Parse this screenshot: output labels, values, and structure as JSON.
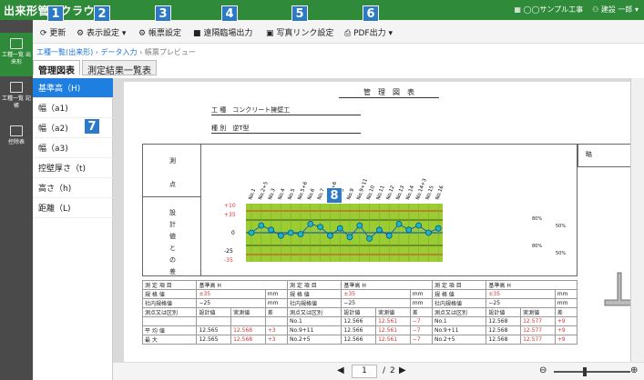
{
  "app": {
    "title": "出来形管理クラウド",
    "org": "◯◯サンプル工事",
    "user": "建設 一郎"
  },
  "toolbar": {
    "refresh": "更新",
    "display": "表示設定",
    "form": "帳票設定",
    "remote": "遠隔臨場出力",
    "photo": "写真リンク設定",
    "pdf": "PDF出力"
  },
  "sidebar": [
    {
      "label": "工種一覧 出来形"
    },
    {
      "label": "工種一覧 記帳"
    },
    {
      "label": "控除表"
    }
  ],
  "breadcrumb": {
    "a": "工種一覧(出来形)",
    "b": "データ入力",
    "c": "帳票プレビュー",
    "sep": "›"
  },
  "tabs": [
    "管理図表",
    "測定結果一覧表"
  ],
  "left_items": [
    "基準高（H)",
    "幅（a1)",
    "幅（a2)",
    "幅（a3)",
    "控壁厚さ（t)",
    "高さ（h)",
    "距離（L)"
  ],
  "badges": [
    "1",
    "2",
    "3",
    "4",
    "5",
    "6",
    "7",
    "8"
  ],
  "sheet": {
    "title": "管　理　図　表",
    "koushu_label": "工 種",
    "koushu": "コンクリート擁壁工",
    "shubetsu_label": "種 別",
    "shubetsu": "逆T型",
    "sokuten_label1": "測",
    "sokuten_label2": "点",
    "vertical_label": "設計値との差",
    "right_label": "略",
    "pct1": "80%",
    "pct2": "50%",
    "axis": {
      "p10": "+10",
      "p35": "+35",
      "zero": "0",
      "m25": "-25",
      "m35": "-35"
    },
    "points": [
      "No.1",
      "No.2+5",
      "No.3",
      "No.4",
      "No.5",
      "No.5+6",
      "No.6",
      "No.7",
      "No.8+6",
      "No.8",
      "No.9",
      "No.9+11",
      "No.10",
      "No.11",
      "No.12",
      "No.13",
      "No.14",
      "No.14+3",
      "No.15",
      "No.16"
    ],
    "rows": {
      "measure_item": "測 定 項 目",
      "kijun": "基準高 H",
      "kikaku": "規 格 値",
      "kikaku_v": "±35",
      "shanai": "社内規格値",
      "shanai_v": "−25",
      "mm": "mm",
      "kubun": "測点又は区別",
      "c1": "設計値",
      "c2": "実測値",
      "c3": "差",
      "heikin": "平 均 値",
      "saidai": "最 大",
      "no1": "No.1",
      "no911": "No.9+11",
      "no25": "No.2+5",
      "v1": "12.565",
      "v2": "12.568",
      "v3": "+3",
      "v4": "12.566",
      "v5": "12.561",
      "v6": "−7",
      "v7": "12.568",
      "v8": "12.577",
      "v9": "+9"
    }
  },
  "pager": {
    "current": "1",
    "total": "2",
    "sep": "/"
  }
}
